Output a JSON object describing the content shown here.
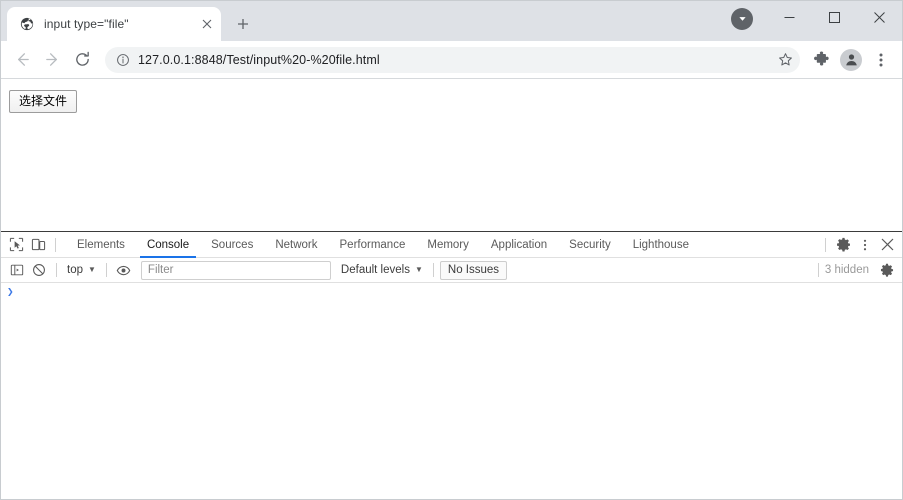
{
  "browser": {
    "tab": {
      "title": "input type=\"file\"",
      "favicon_icon": "globe-icon",
      "close_icon": "close-icon"
    },
    "new_tab_label": "+",
    "titlebar": {
      "download_icon": "download-bubble-icon",
      "minimize_label": "—",
      "maximize_label": "□",
      "close_label": "✕"
    },
    "toolbar": {
      "back_icon": "back-arrow-icon",
      "forward_icon": "forward-arrow-icon",
      "reload_icon": "reload-icon",
      "info_icon": "page-info-icon",
      "url": "127.0.0.1:8848/Test/input%20-%20file.html",
      "star_icon": "bookmark-star-icon",
      "extensions_icon": "puzzle-piece-icon",
      "profile_icon": "profile-avatar-icon",
      "menu_icon": "three-dot-menu-icon"
    }
  },
  "page": {
    "file_input_button_label": "选择文件"
  },
  "devtools": {
    "inspect_icon": "inspect-element-icon",
    "device_toolbar_icon": "device-toolbar-icon",
    "tabs": [
      {
        "label": "Elements",
        "active": false
      },
      {
        "label": "Console",
        "active": true
      },
      {
        "label": "Sources",
        "active": false
      },
      {
        "label": "Network",
        "active": false
      },
      {
        "label": "Performance",
        "active": false
      },
      {
        "label": "Memory",
        "active": false
      },
      {
        "label": "Application",
        "active": false
      },
      {
        "label": "Security",
        "active": false
      },
      {
        "label": "Lighthouse",
        "active": false
      }
    ],
    "settings_icon": "gear-icon",
    "more_icon": "three-dot-menu-icon",
    "close_icon": "close-icon",
    "console_toolbar": {
      "sidebar_icon": "console-sidebar-icon",
      "clear_icon": "clear-console-icon",
      "context_label": "top",
      "context_caret": "▼",
      "eye_icon": "live-expression-eye-icon",
      "filter_placeholder": "Filter",
      "levels_label": "Default levels",
      "levels_caret": "▼",
      "issues_label": "No Issues",
      "hidden_label": "3 hidden",
      "console_settings_icon": "gear-icon"
    },
    "console": {
      "prompt_symbol": "❯"
    }
  },
  "colors": {
    "tabstrip_bg": "#dee1e6",
    "active_tab_bg": "#ffffff",
    "omnibox_bg": "#f1f3f4",
    "devtools_accent": "#1a73e8",
    "prompt_blue": "#3b78e7"
  }
}
